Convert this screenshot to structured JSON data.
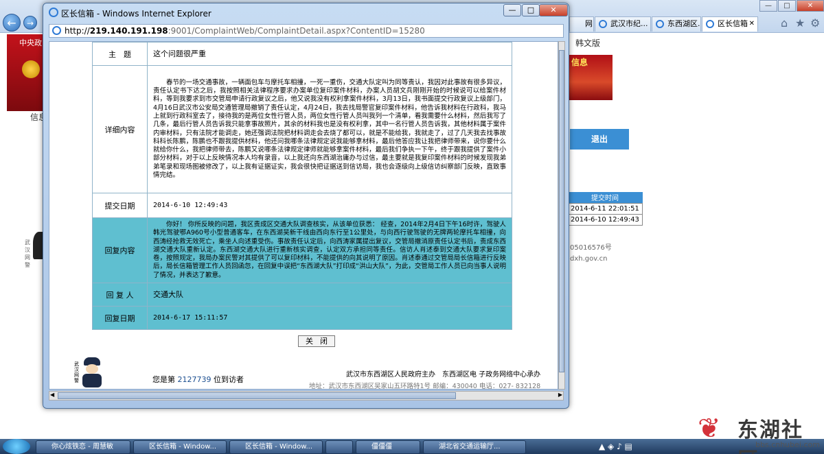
{
  "bg_browser": {
    "tabs": [
      {
        "label": "网"
      },
      {
        "label": "武汉市纪..."
      },
      {
        "label": "东西湖区..."
      },
      {
        "label": "区长信箱"
      }
    ],
    "left_banner_text": "中央政",
    "left_caption": "信息",
    "right_caption": "韩文版",
    "right_banner_text": "信息",
    "logout_label": "退出",
    "side_table": {
      "header": "提交时间",
      "rows": [
        "2014-6-11 22:01:51",
        "2014-6-10 12:49:43"
      ]
    },
    "icp_text": "05016576号",
    "domain_text": "dxh.gov.cn",
    "police_text": "武汉网警"
  },
  "popup": {
    "title": "区长信箱 - Windows Internet Explorer",
    "controls": {
      "minimize": "—",
      "maximize": "□",
      "close": "✕"
    },
    "address": {
      "prefix": "http://",
      "host": "219.140.191.198",
      "path": ":9001/ComplaintWeb/ComplaintDetail.aspx?ContentID=15280"
    }
  },
  "detail": {
    "subject_label": "主　题",
    "subject_value": "这个问题很严重",
    "content_label": "详细内容",
    "content_value": "春节的一场交通事故，一辆面包车与摩托车相撞，一死一重伤，交通大队定叫为同等责认，我因对此事故有很多异议，责任认定书下达之后，我按照相关法律程序要求办案单位复印案件材料，办案人员胡文兵刚刚开始的时候说可以给案件材料，等到我要求到市交管局申请行政复议之后，他又说我没有权利拿案件材料，3月13日，我书面提交行政复议上级部门，4月16日武汉市公安局交通管理局撤销了责任认定，4月24日，我去找局警官复印案件材料，他告诉我材料在行政科，我马上就到行政科室去了，接待我的是两位女性行管人员，两位女性行管人员叫我列一个清单，看我需要什么材料，然后我写了几条，最后行管人员告诉我只能拿事故照片，其余的材料我也是没有权利拿，其中一名行管人员告诉我，其他材料属于案件内审材料，只有法院才能调走，她还强调法院把材料调走会去烧了都可以，就是不能给我，我就走了，过了几天我去找事故科科长陈鹏，陈鹏也不跟我提供材料，他还问我哪条法律规定说我能够拿材料，最后他答应我让我把律师带来，说你要什么就给你什么，我把律师带去，陈鹏又说哪条法律规定律师就能够拿案件材料，最后我们争执一下午，终于跟我提供了案件小部分材料，对于以上反映情况本人均有录音，以上我还向东西湖治庸办与过信，最主要就是我复印案件材料的时候发现我弟弟笔录和现场图被修改了，以上我有证据证实，我会很快把证据送到信访局，我也会逐级向上级信访纠察部门反映，直致事情完结。",
    "date_label": "提交日期",
    "date_value": "2014-6-10 12:49:43",
    "reply_label": "回复内容",
    "reply_value": "你好！ 你所反映的问题，我区责成区交通大队调查核实，从该单位获悉： 经查，2014年2月4日下午16时许，驾驶人韩光驾驶鄂A960号小型普通客车，在东西湖吴新干线由西向东行至1公里处，与向西行驶驾驶的无牌两轮摩托车相撞，向西涛经抢救无效死亡，乘坐人向述重受伤。事故责任认定后，向西涛家属提出复议，交管局撤消原责任认定书后，责成东西湖交通大队重新认定。东西湖交通大队进行重新核实调查，认定双方承担同等责任。信访人肖述泰到交通大队要求复印案卷，按照规定，我局办案民警对其提供了可以复印材料，不能提供的向其说明了原因。肖述泰通过交管局局长信箱进行反映后，局长信箱管理工作人员回函忽，在回复中误把“东西湖大队”打印成“洪山大队”，为此，交管局工作人员已向当事人说明了情况，并表达了歉意。",
    "replier_label": "回 复 人",
    "replier_value": "交通大队",
    "reply_date_label": "回复日期",
    "reply_date_value": "2014-6-17 15:11:57",
    "close_label": "关闭"
  },
  "footer": {
    "visitor_prefix": "您是第",
    "visitor_count": "2127739",
    "visitor_suffix": "位到访者",
    "sponsor": "武汉市东西湖区人民政府主办　东西湖区电 子政务网络中心承办",
    "address": "地址：武汉市东西湖区吴家山五环路特1号 邮编：430040 电话：027- 832128"
  },
  "taskbar": {
    "items": [
      {
        "label": "你心炫铁恋 - 周慧敏"
      },
      {
        "label": "区长信箱 - Window..."
      },
      {
        "label": "区长信箱 - Window..."
      },
      {
        "label": ""
      },
      {
        "label": "僵僵僵"
      },
      {
        "label": "湖北省交通运输厅..."
      }
    ]
  },
  "watermark": {
    "name": "东湖社区",
    "url": "bbs.cnhubei.com"
  }
}
